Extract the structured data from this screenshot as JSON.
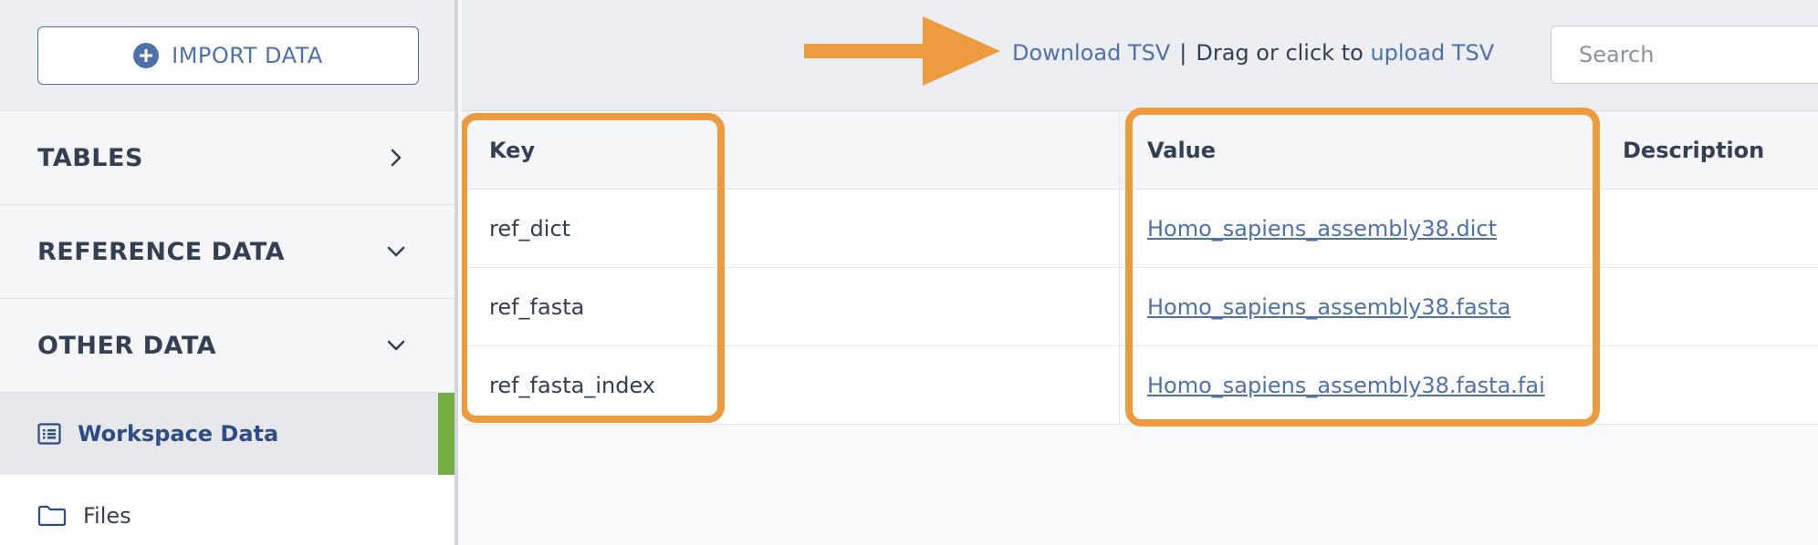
{
  "sidebar": {
    "import_button_label": "IMPORT DATA",
    "sections": [
      {
        "label": "TABLES",
        "chevron": "chevron-right-icon"
      },
      {
        "label": "REFERENCE DATA",
        "chevron": "chevron-down-icon"
      },
      {
        "label": "OTHER DATA",
        "chevron": "chevron-down-icon"
      }
    ],
    "items": [
      {
        "label": "Workspace Data",
        "icon": "list-icon",
        "active": true
      },
      {
        "label": "Files",
        "icon": "folder-icon",
        "active": false
      }
    ]
  },
  "toolbar": {
    "download_label": "Download TSV",
    "separator": "|",
    "drag_text": "Drag or click to",
    "upload_label": "upload TSV",
    "search_placeholder": "Search"
  },
  "table": {
    "headers": [
      "Key",
      "Value",
      "Description"
    ],
    "rows": [
      {
        "key": "ref_dict",
        "value": "Homo_sapiens_assembly38.dict",
        "description": ""
      },
      {
        "key": "ref_fasta",
        "value": "Homo_sapiens_assembly38.fasta",
        "description": ""
      },
      {
        "key": "ref_fasta_index",
        "value": "Homo_sapiens_assembly38.fasta.fai",
        "description": ""
      }
    ]
  },
  "colors": {
    "accent": "#4d72aa",
    "highlight": "#ec9b3f",
    "active_bar": "#74ae43"
  }
}
